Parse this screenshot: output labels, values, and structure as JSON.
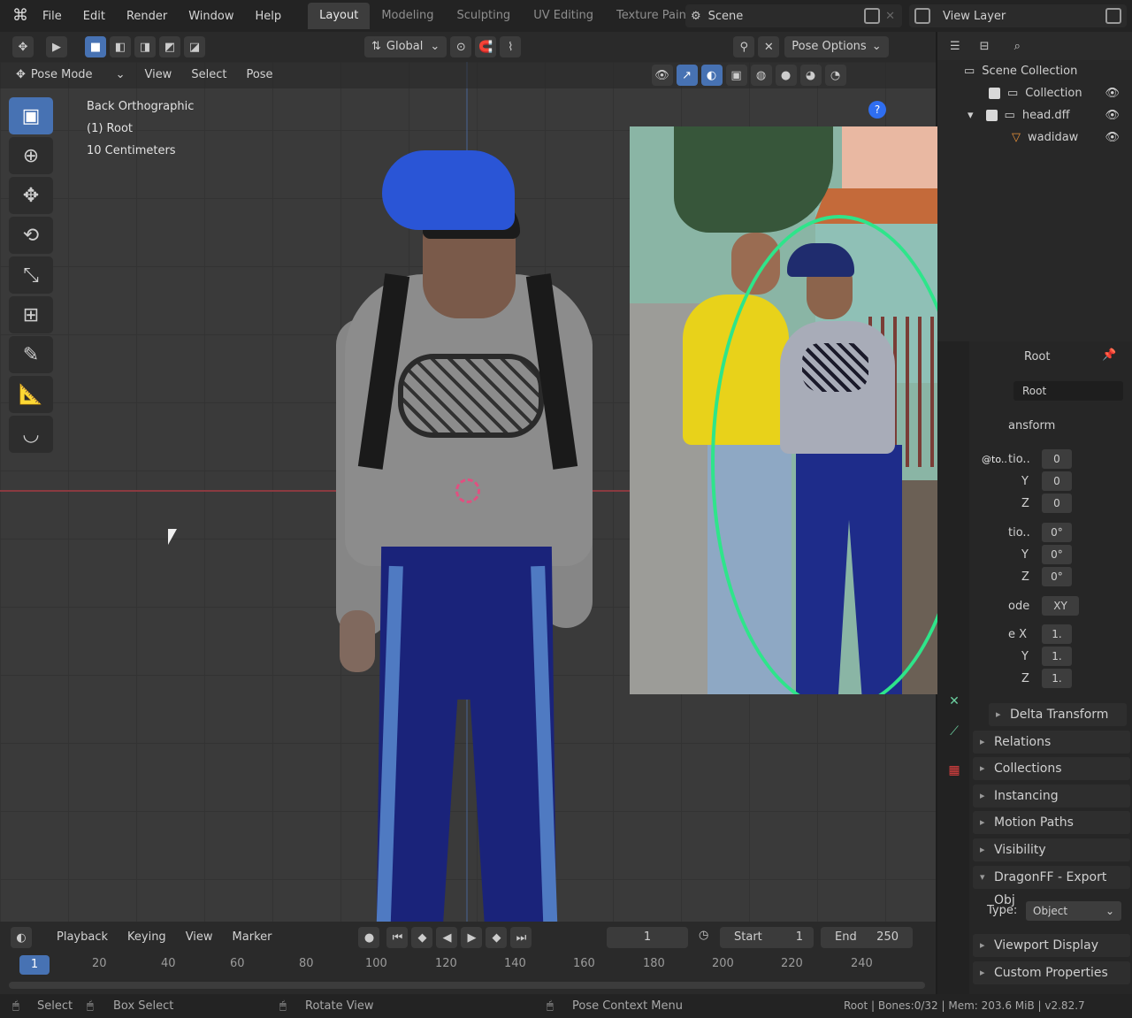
{
  "topbar": {
    "menu": [
      "File",
      "Edit",
      "Render",
      "Window",
      "Help"
    ],
    "workspaces": [
      "Layout",
      "Modeling",
      "Sculpting",
      "UV Editing",
      "Texture Paint"
    ],
    "active_workspace": "Layout",
    "scene": "Scene",
    "view_layer": "View Layer"
  },
  "viewport_header": {
    "orientation": "Global",
    "pose_options": "Pose Options",
    "mode": "Pose Mode",
    "menus": [
      "View",
      "Select",
      "Pose"
    ]
  },
  "viewport_overlay": {
    "view_name": "Back Orthographic",
    "object_info": "(1) Root",
    "scale": "10 Centimeters"
  },
  "outliner": {
    "items": [
      {
        "label": "Scene Collection"
      },
      {
        "label": "Collection"
      },
      {
        "label": "head.dff"
      },
      {
        "label": "wadidaw"
      }
    ]
  },
  "properties": {
    "bone_name": "Root",
    "bone_field": "Root",
    "transform_label": "ansform",
    "location": {
      "label": "tio..",
      "x": "0",
      "y": "0",
      "z": "0"
    },
    "rotation": {
      "label": "tio..",
      "x": "0°",
      "y": "0°",
      "z": "0°"
    },
    "mode": {
      "label": "ode",
      "value": "XY"
    },
    "scale": {
      "label": "e X",
      "x": "1.",
      "y": "1.",
      "z": "1."
    },
    "axis_y": "Y",
    "axis_z": "Z",
    "sections": [
      {
        "label": "Delta Transform",
        "open": false
      },
      {
        "label": "Relations",
        "open": false
      },
      {
        "label": "Collections",
        "open": false
      },
      {
        "label": "Instancing",
        "open": false
      },
      {
        "label": "Motion Paths",
        "open": false
      },
      {
        "label": "Visibility",
        "open": false
      },
      {
        "label": "DragonFF - Export Obj",
        "open": true
      }
    ],
    "type_label": "Type:",
    "type_value": "Object",
    "sections_bottom": [
      {
        "label": "Viewport Display"
      },
      {
        "label": "Custom Properties"
      }
    ],
    "watermark": "@to.."
  },
  "timeline": {
    "menus": [
      "Playback",
      "Keying",
      "View",
      "Marker"
    ],
    "current_frame": "1",
    "start_label": "Start",
    "start_value": "1",
    "end_label": "End",
    "end_value": "250",
    "ruler": [
      "1",
      "20",
      "40",
      "60",
      "80",
      "100",
      "120",
      "140",
      "160",
      "180",
      "200",
      "220",
      "240"
    ]
  },
  "statusbar": {
    "select": "Select",
    "box_select": "Box Select",
    "rotate_view": "Rotate View",
    "context_menu": "Pose Context Menu",
    "stats": "Root | Bones:0/32 | Mem: 203.6 MiB | v2.82.7"
  },
  "colors": {
    "accent": "#4772b3",
    "highlight_oval": "#2ee58a",
    "x_axis": "#8a3a40"
  }
}
